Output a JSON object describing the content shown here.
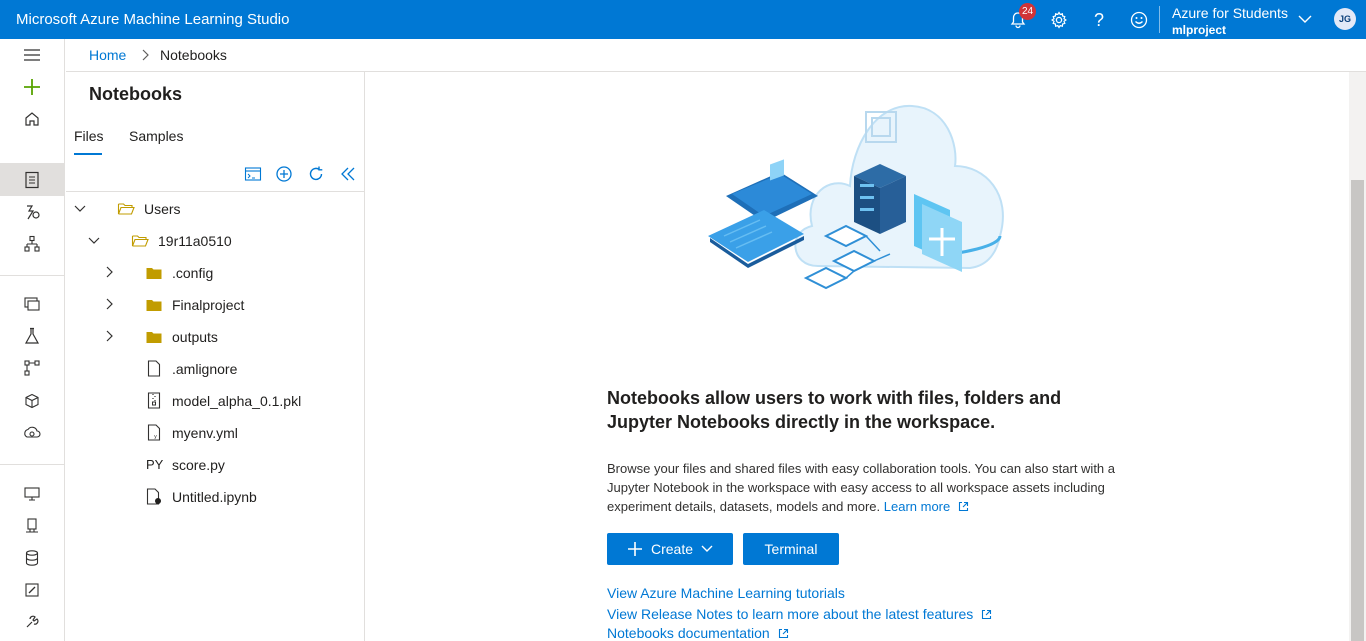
{
  "topbar": {
    "app_title": "Microsoft Azure Machine Learning Studio",
    "notifications_count": "24",
    "account_name": "Azure for Students",
    "workspace_name": "mlproject",
    "avatar_initials": "JG"
  },
  "breadcrumb": {
    "home": "Home",
    "current": "Notebooks"
  },
  "panel": {
    "title": "Notebooks",
    "tabs": [
      "Files",
      "Samples"
    ],
    "tree": {
      "root": "Users",
      "user_folder": "19r11a0510",
      "folders": [
        ".config",
        "Finalproject",
        "outputs"
      ],
      "files": [
        ".amlignore",
        "model_alpha_0.1.pkl",
        "myenv.yml",
        "score.py",
        "Untitled.ipynb"
      ],
      "py_badge": "PY"
    }
  },
  "main": {
    "heading": "Notebooks allow users to work with files, folders and Jupyter Notebooks directly in the workspace.",
    "description": "Browse your files and shared files with easy collaboration tools. You can also start with a Jupyter Notebook in the workspace with easy access to all workspace assets including experiment details, datasets, models and more.",
    "learn_more": "Learn more",
    "create_label": "Create",
    "terminal_label": "Terminal",
    "links": [
      "View Azure Machine Learning tutorials",
      "View Release Notes to learn more about the latest features",
      "Notebooks documentation"
    ]
  },
  "colors": {
    "accent": "#0078d4",
    "folder": "#c19c00",
    "badge": "#d13438"
  }
}
